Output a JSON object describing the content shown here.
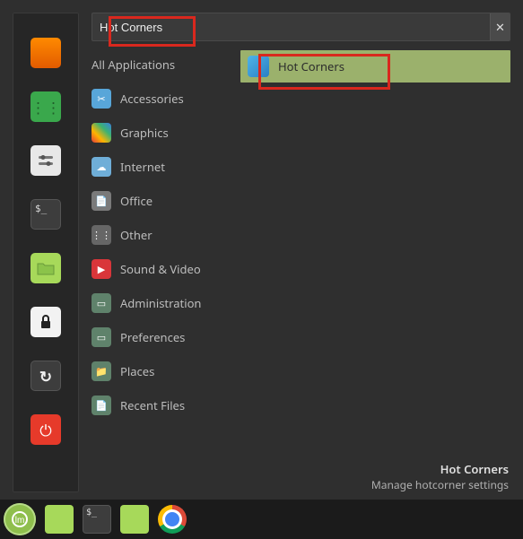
{
  "search": {
    "value": "Hot Corners",
    "placeholder": ""
  },
  "favorites": [
    {
      "name": "firefox",
      "glyph": "🦊"
    },
    {
      "name": "software-manager",
      "glyph": "⋮⋮⋮"
    },
    {
      "name": "system-settings",
      "glyph": "⚙"
    },
    {
      "name": "terminal",
      "glyph": ""
    },
    {
      "name": "files",
      "glyph": "📁"
    },
    {
      "name": "lock-screen",
      "glyph": "🔒"
    },
    {
      "name": "logout",
      "glyph": "↻"
    },
    {
      "name": "shutdown",
      "glyph": "⏻"
    }
  ],
  "categories": [
    {
      "label": "All Applications",
      "icon": "ci-all"
    },
    {
      "label": "Accessories",
      "icon": "ci-acc"
    },
    {
      "label": "Graphics",
      "icon": "ci-gfx"
    },
    {
      "label": "Internet",
      "icon": "ci-net"
    },
    {
      "label": "Office",
      "icon": "ci-off"
    },
    {
      "label": "Other",
      "icon": "ci-oth"
    },
    {
      "label": "Sound & Video",
      "icon": "ci-snd"
    },
    {
      "label": "Administration",
      "icon": "ci-adm"
    },
    {
      "label": "Preferences",
      "icon": "ci-pref"
    },
    {
      "label": "Places",
      "icon": "ci-plc"
    },
    {
      "label": "Recent Files",
      "icon": "ci-rec"
    }
  ],
  "results": [
    {
      "label": "Hot Corners",
      "icon": "hot-corners"
    }
  ],
  "footer": {
    "title": "Hot Corners",
    "subtitle": "Manage hotcorner settings"
  },
  "taskbar": [
    {
      "name": "start-menu",
      "type": "start"
    },
    {
      "name": "files-window",
      "type": "folder"
    },
    {
      "name": "terminal-window",
      "type": "term"
    },
    {
      "name": "files-window-2",
      "type": "folder"
    },
    {
      "name": "chrome-window",
      "type": "chrome"
    }
  ],
  "annotations": {
    "highlight_search": true,
    "highlight_result": true
  }
}
